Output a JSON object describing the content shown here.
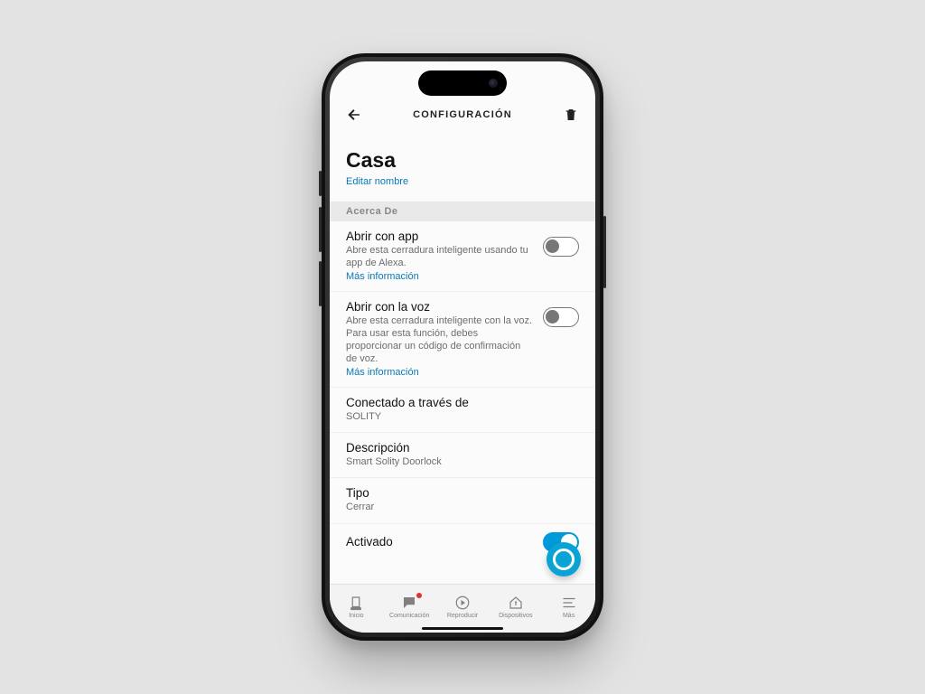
{
  "header": {
    "title": "CONFIGURACIÓN"
  },
  "device": {
    "name": "Casa",
    "edit_label": "Editar nombre"
  },
  "about": {
    "header": "Acerca De",
    "open_app": {
      "title": "Abrir con app",
      "sub": "Abre esta cerradura inteligente usando tu app de Alexa.",
      "more": "Más información",
      "on": false
    },
    "open_voice": {
      "title": "Abrir con la voz",
      "sub": "Abre esta cerradura inteligente con la voz. Para usar esta función, debes proporcionar un código de confirmación de voz.",
      "more": "Más información",
      "on": false
    },
    "connected": {
      "title": "Conectado a través de",
      "value": "SOLITY"
    },
    "description": {
      "title": "Descripción",
      "value": "Smart Solity Doorlock"
    },
    "type": {
      "title": "Tipo",
      "value": "Cerrar"
    },
    "enabled": {
      "title": "Activado",
      "on": true
    }
  },
  "tabs": {
    "home": "Inicio",
    "comm": "Comunicación",
    "play": "Reproducir",
    "devices": "Dispositivos",
    "more": "Más"
  }
}
